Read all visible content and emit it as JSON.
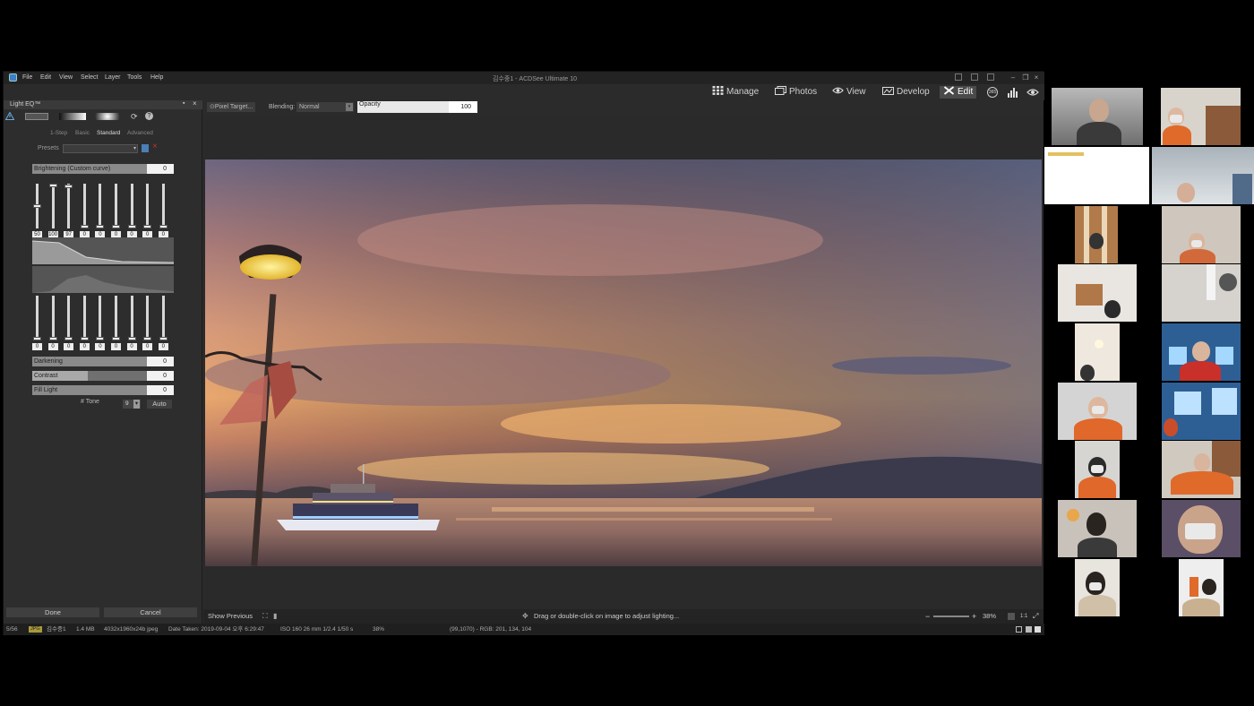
{
  "titlebar": {
    "menus": [
      "File",
      "Edit",
      "View",
      "Select",
      "Layer",
      "Tools",
      "Help"
    ],
    "title": "김수중1 - ACDSee Ultimate 10"
  },
  "modes": [
    {
      "label": "Manage",
      "icon": "grid-icon"
    },
    {
      "label": "Photos",
      "icon": "photos-icon"
    },
    {
      "label": "View",
      "icon": "eye-icon"
    },
    {
      "label": "Develop",
      "icon": "develop-icon"
    },
    {
      "label": "Edit",
      "icon": "tools-icon",
      "active": true
    }
  ],
  "panel": {
    "title": "Light EQ™",
    "tabs": [
      "1-Step",
      "Basic",
      "Standard",
      "Advanced"
    ],
    "active_tab": "Standard",
    "presets_label": "Presets",
    "brightening": {
      "label": "Brightening (Custom curve)",
      "value": "0"
    },
    "top_sliders": [
      "50",
      "100",
      "97",
      "0",
      "0",
      "0",
      "0",
      "0",
      "0"
    ],
    "top_slider_levels": [
      50,
      100,
      97,
      0,
      0,
      0,
      0,
      0,
      0
    ],
    "bottom_sliders": [
      "0",
      "0",
      "0",
      "0",
      "0",
      "0",
      "0",
      "0",
      "0"
    ],
    "darkening": {
      "label": "Darkening",
      "value": "0"
    },
    "contrast": {
      "label": "Contrast",
      "value": "0"
    },
    "fill_light": {
      "label": "Fill Light",
      "value": "0"
    },
    "tone_label": "# Tone",
    "tone_value": "9",
    "auto_label": "Auto",
    "done_label": "Done",
    "cancel_label": "Cancel"
  },
  "edit_toolbar": {
    "pixel_target": "Pixel Target...",
    "blending_label": "Blending:",
    "blending_value": "Normal",
    "opacity_label": "Opacity",
    "opacity_value": "100"
  },
  "infobar": {
    "show_previous": "Show Previous",
    "hint": "Drag or double-click on image to adjust lighting...",
    "zoom": "38%",
    "ratio": "1:1"
  },
  "status": {
    "index": "5/56",
    "format": "JPG",
    "name": "김수중1",
    "size": "1.4 MB",
    "dims": "4032x1960x24b jpeg",
    "date": "Date Taken: 2019-09-04 오후 6:29:47",
    "exif": "ISO 160   26 mm   1/2.4   1/50 s",
    "zoom": "38%",
    "pixel": "(99,1070) - RGB: 201, 134, 104"
  },
  "colors": {
    "accent": "#4a90d9",
    "panel": "#2d2d2d",
    "window": "#2b2b2b"
  }
}
